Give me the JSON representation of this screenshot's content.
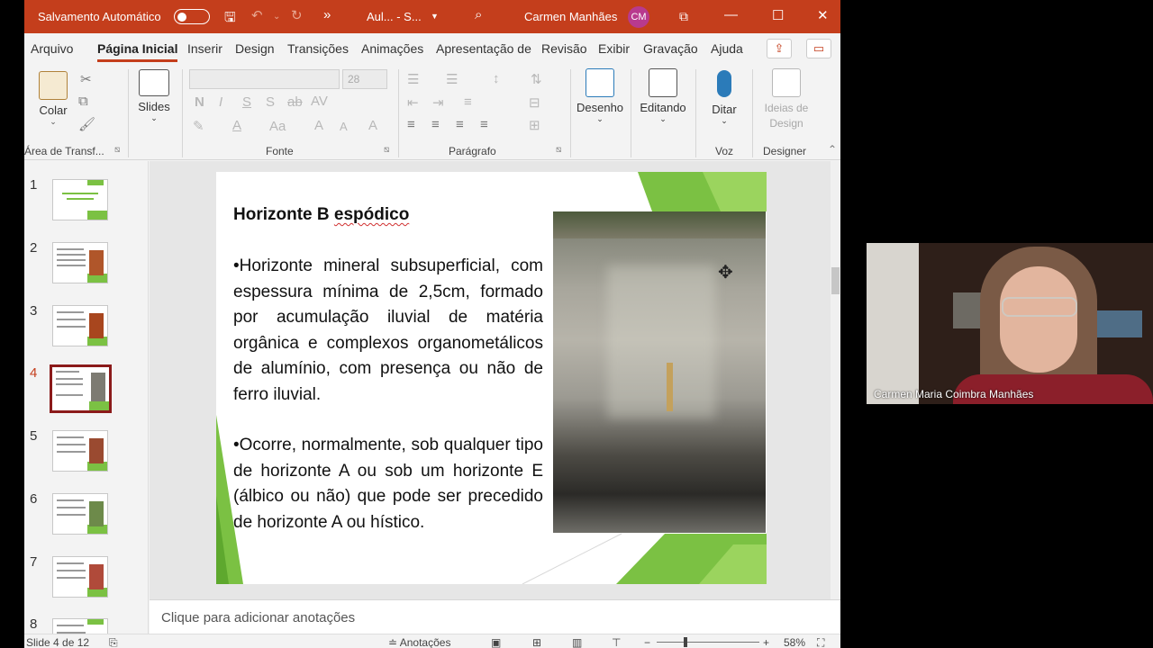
{
  "titlebar": {
    "autosave_label": "Salvamento Automático",
    "doc_name": "Aul... - S...",
    "user_name": "Carmen Manhães",
    "user_initials": "CM"
  },
  "tabs": [
    "Arquivo",
    "Página Inicial",
    "Inserir",
    "Design",
    "Transições",
    "Animações",
    "Apresentação de",
    "Revisão",
    "Exibir",
    "Gravação",
    "Ajuda"
  ],
  "ribbon": {
    "paste_label": "Colar",
    "clipboard_group": "Área de Transf...",
    "slides_label": "Slides",
    "font_name": "",
    "font_size": "28",
    "font_group": "Fonte",
    "paragraph_group": "Parágrafo",
    "drawing_label": "Desenho",
    "editing_label": "Editando",
    "dictate_label": "Ditar",
    "voice_group": "Voz",
    "design_ideas_line1": "Ideias de",
    "design_ideas_line2": "Design",
    "designer_group": "Designer"
  },
  "thumbnails": {
    "numbers": [
      "1",
      "2",
      "3",
      "4",
      "5",
      "6",
      "7",
      "8"
    ],
    "selected": "4"
  },
  "slide": {
    "title": "Horizonte B ",
    "title_marked": "espódico",
    "paragraph1": "•Horizonte mineral subsuperficial, com espessura mínima de 2,5cm, formado por acumulação iluvial de matéria orgânica e complexos organometálicos de alumínio, com presença ou não de ferro iluvial.",
    "paragraph2": "•Ocorre, normalmente, sob qualquer tipo de horizonte A ou sob um horizonte E (álbico ou não) que pode ser precedido de horizonte A ou hístico."
  },
  "notes_placeholder": "Clique para adicionar anotações",
  "status": {
    "slide_counter": "Slide 4 de 12",
    "notes_button": "Anotações",
    "zoom": "58%"
  },
  "webcam": {
    "participant_name": "Carmen Maria Coimbra Manhães"
  },
  "colors": {
    "accent": "#c43e1c",
    "slide_green": "#7bc143",
    "selected_thumb_border": "#8b1a1a"
  }
}
